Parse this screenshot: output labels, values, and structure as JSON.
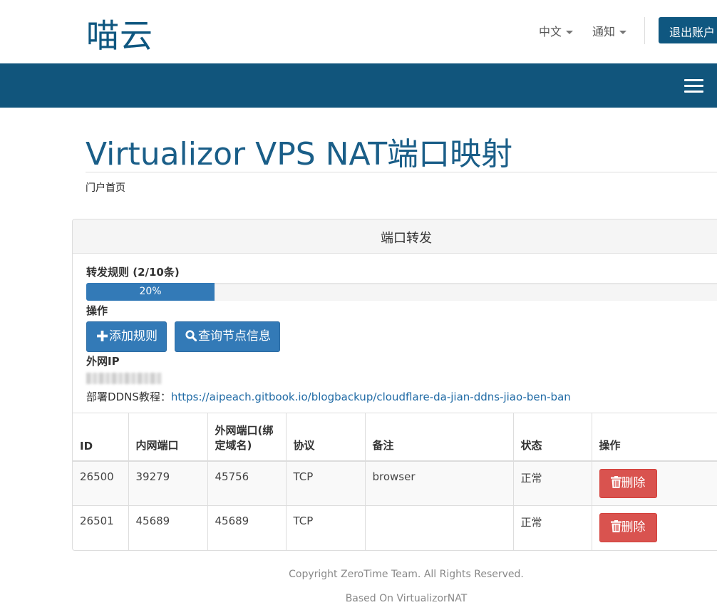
{
  "header": {
    "logo": "喵云",
    "lang_label": "中文",
    "notify_label": "通知",
    "logout_label": "退出账户"
  },
  "page": {
    "title": "Virtualizor VPS NAT端口映射",
    "breadcrumb": "门户首页"
  },
  "panel": {
    "title": "端口转发",
    "rules_label": "转发规则 (2/10条)",
    "progress": {
      "percent": 20,
      "text": "20%"
    },
    "actions_label": "操作",
    "add_rule_label": "添加规则",
    "node_info_label": "查询节点信息",
    "ip_label": "外网IP",
    "ddns_prefix": "部署DDNS教程：",
    "ddns_link": "https://aipeach.gitbook.io/blogbackup/cloudflare-da-jian-ddns-jiao-ben-ban"
  },
  "table": {
    "headers": [
      "ID",
      "内网端口",
      "外网端口(绑定域名)",
      "协议",
      "备注",
      "状态",
      "操作"
    ],
    "rows": [
      {
        "id": "26500",
        "internal": "39279",
        "external": "45756",
        "protocol": "TCP",
        "note": "browser",
        "status": "正常",
        "action": "删除"
      },
      {
        "id": "26501",
        "internal": "45689",
        "external": "45689",
        "protocol": "TCP",
        "note": "",
        "status": "正常",
        "action": "删除"
      }
    ]
  },
  "footer": {
    "copyright": "Copyright ZeroTime Team. All Rights Reserved.",
    "based_on": "Based On VirtualizorNAT"
  },
  "colors": {
    "brand": "#0f5780",
    "navbar": "#11557c",
    "primary": "#337ab7",
    "danger": "#d9534f",
    "success": "#3c8f2f"
  },
  "icons": [
    "caret-down-icon",
    "hamburger-menu-icon",
    "plus-icon",
    "search-icon",
    "trash-icon"
  ]
}
